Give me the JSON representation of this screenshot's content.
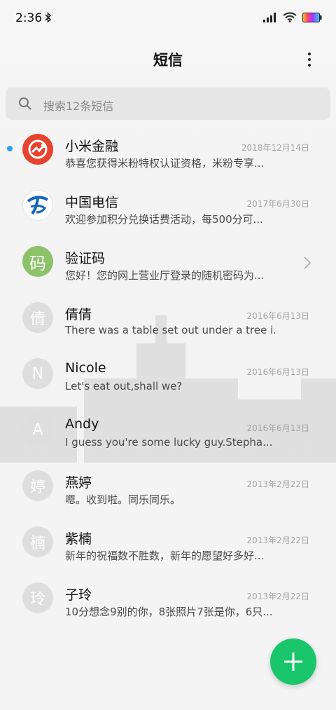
{
  "status_bar": {
    "time": "2:36",
    "icons": [
      "bluetooth-icon",
      "signal-icon",
      "wifi-icon",
      "battery-icon"
    ]
  },
  "header": {
    "title": "短信"
  },
  "search": {
    "placeholder": "搜索12条短信"
  },
  "colors": {
    "fab": "#19c66b",
    "unread_dot": "#2ea0f0",
    "mi_avatar": "#e8432e",
    "verify_avatar": "#8cc26a"
  },
  "conversations": [
    {
      "name": "小米金融",
      "date": "2018年12月14日",
      "preview": "恭喜您获得米粉特权认证资格，米粉专享...",
      "avatar_text": "",
      "unread": true
    },
    {
      "name": "中国电信",
      "date": "2017年6月30日",
      "preview": "欢迎参加积分兑换话费活动，每500分可...",
      "avatar_text": ""
    },
    {
      "name": "验证码",
      "date": "",
      "preview": "您好！您的网上营业厅登录的随机密码为...",
      "avatar_text": "码"
    },
    {
      "name": "倩倩",
      "date": "2016年6月13日",
      "preview": "There was a table set out under a tree i...",
      "avatar_text": "倩"
    },
    {
      "name": "Nicole",
      "date": "2016年6月13日",
      "preview": "Let's eat out,shall we?",
      "avatar_text": "N"
    },
    {
      "name": "Andy",
      "date": "2016年6月13日",
      "preview": "I guess you're some lucky guy.Stepha...",
      "avatar_text": "A"
    },
    {
      "name": "燕婷",
      "date": "2013年2月22日",
      "preview": "嗯。收到啦。同乐同乐。",
      "avatar_text": "婷"
    },
    {
      "name": "紫楠",
      "date": "2013年2月22日",
      "preview": "新年的祝福数不胜数，新年的愿望好多好...",
      "avatar_text": "楠"
    },
    {
      "name": "子玲",
      "date": "2013年2月22日",
      "preview": "10分想念9别的你，8张照片7张是你，6只...",
      "avatar_text": "玲"
    }
  ],
  "fab": {
    "icon": "plus-icon"
  }
}
